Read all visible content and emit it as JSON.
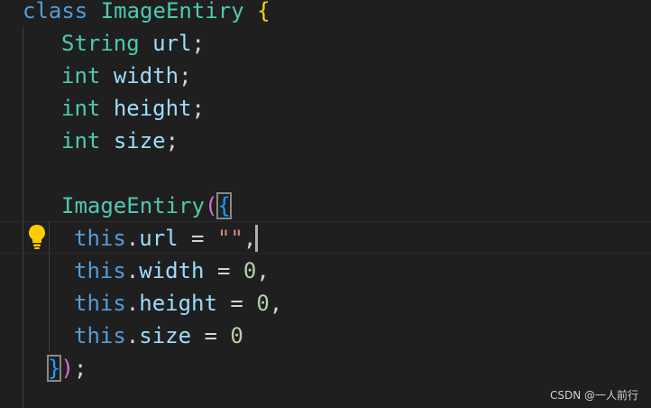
{
  "code": {
    "class_keyword": "class",
    "class_name": "ImageEntiry",
    "open_brace": "{",
    "fields": [
      {
        "type": "String",
        "name": "url"
      },
      {
        "type": "int",
        "name": "width"
      },
      {
        "type": "int",
        "name": "height"
      },
      {
        "type": "int",
        "name": "size"
      }
    ],
    "semicolon": ";",
    "ctor_name": "ImageEntiry",
    "open_paren": "(",
    "ctor_open_brace": "{",
    "this_kw": "this",
    "dot": ".",
    "assign": " = ",
    "comma": ",",
    "assignments": [
      {
        "field": "url",
        "value": "\"\""
      },
      {
        "field": "width",
        "value": "0"
      },
      {
        "field": "height",
        "value": "0"
      },
      {
        "field": "size",
        "value": "0"
      }
    ],
    "close_brace": "}",
    "close_paren": ")",
    "end_semicolon": ";"
  },
  "watermark": "CSDN @一人前行",
  "colors": {
    "background": "#1f1f1f",
    "keyword": "#569cd6",
    "type": "#4ec9b0",
    "variable": "#9cdcfe",
    "number": "#b5cea8",
    "string": "#ce9178",
    "bracket_gold": "#ffd700",
    "bracket_purple": "#da70d6",
    "bracket_blue": "#179fff",
    "lightbulb": "#ffcc00"
  }
}
